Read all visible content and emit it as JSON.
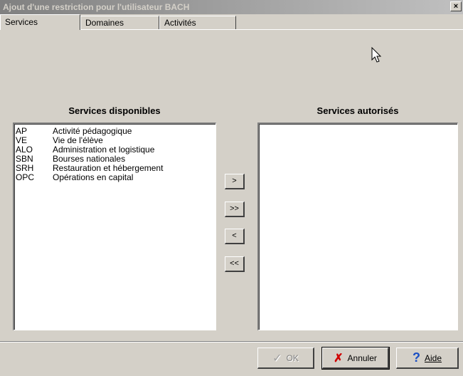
{
  "window": {
    "title": "Ajout d'une restriction pour l'utilisateur BACH",
    "close_label": "×"
  },
  "tabs": [
    {
      "label": "Services",
      "active": true
    },
    {
      "label": "Domaines",
      "active": false
    },
    {
      "label": "Activités",
      "active": false
    }
  ],
  "available": {
    "heading": "Services disponibles",
    "items": [
      {
        "code": "AP",
        "label": "Activité pédagogique"
      },
      {
        "code": "VE",
        "label": "Vie de l'élève"
      },
      {
        "code": "ALO",
        "label": "Administration et logistique"
      },
      {
        "code": "SBN",
        "label": "Bourses nationales"
      },
      {
        "code": "SRH",
        "label": "Restauration et hébergement"
      },
      {
        "code": "OPC",
        "label": "Opérations en capital"
      }
    ]
  },
  "authorized": {
    "heading": "Services autorisés",
    "items": []
  },
  "transfer": {
    "add_one": ">",
    "add_all": ">>",
    "remove_one": "<",
    "remove_all": "<<"
  },
  "buttons": {
    "ok": "OK",
    "cancel": "Annuler",
    "help": "Aide"
  },
  "icons": {
    "ok": "check-icon",
    "cancel": "x-icon",
    "help": "question-icon",
    "cursor": "mouse-pointer-icon"
  },
  "colors": {
    "cancel_icon": "#d00000",
    "help_icon": "#1a4fc4"
  }
}
